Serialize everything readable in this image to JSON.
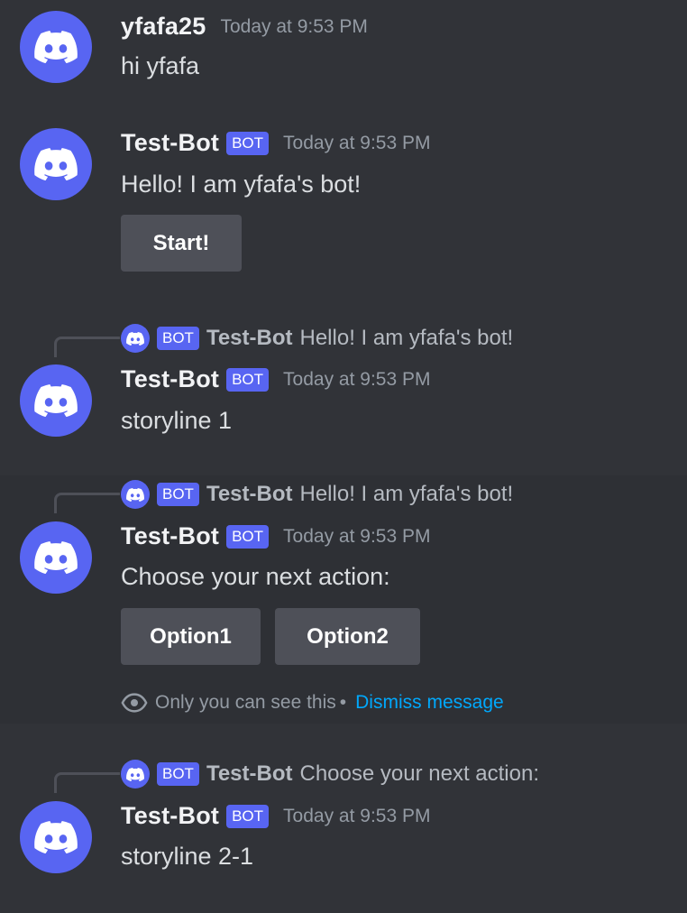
{
  "messages": [
    {
      "username": "yfafa25",
      "timestamp": "Today at 9:53 PM",
      "content": "hi yfafa"
    },
    {
      "username": "Test-Bot",
      "bot_tag": "BOT",
      "timestamp": "Today at 9:53 PM",
      "content": "Hello! I am yfafa's bot!",
      "buttons": [
        "Start!"
      ]
    },
    {
      "reply": {
        "bot_tag": "BOT",
        "name": "Test-Bot",
        "text": "Hello! I am yfafa's bot!"
      },
      "username": "Test-Bot",
      "bot_tag": "BOT",
      "timestamp": "Today at 9:53 PM",
      "content": "storyline 1"
    },
    {
      "reply": {
        "bot_tag": "BOT",
        "name": "Test-Bot",
        "text": "Hello! I am yfafa's bot!"
      },
      "username": "Test-Bot",
      "bot_tag": "BOT",
      "timestamp": "Today at 9:53 PM",
      "content": "Choose your next action:",
      "buttons": [
        "Option1",
        "Option2"
      ],
      "ephemeral": {
        "note": "Only you can see this",
        "separator": "•",
        "dismiss": "Dismiss message"
      }
    },
    {
      "reply": {
        "bot_tag": "BOT",
        "name": "Test-Bot",
        "text": "Choose your next action:"
      },
      "username": "Test-Bot",
      "bot_tag": "BOT",
      "timestamp": "Today at 9:53 PM",
      "content": "storyline 2-1"
    }
  ],
  "colors": {
    "background": "#313338",
    "ephemeral_background": "#2e3035",
    "blurple": "#5865f2",
    "button": "#4e5058",
    "link": "#00a8fc"
  },
  "icons": {
    "avatar": "discord-logo-icon",
    "ephemeral": "eye-icon"
  }
}
